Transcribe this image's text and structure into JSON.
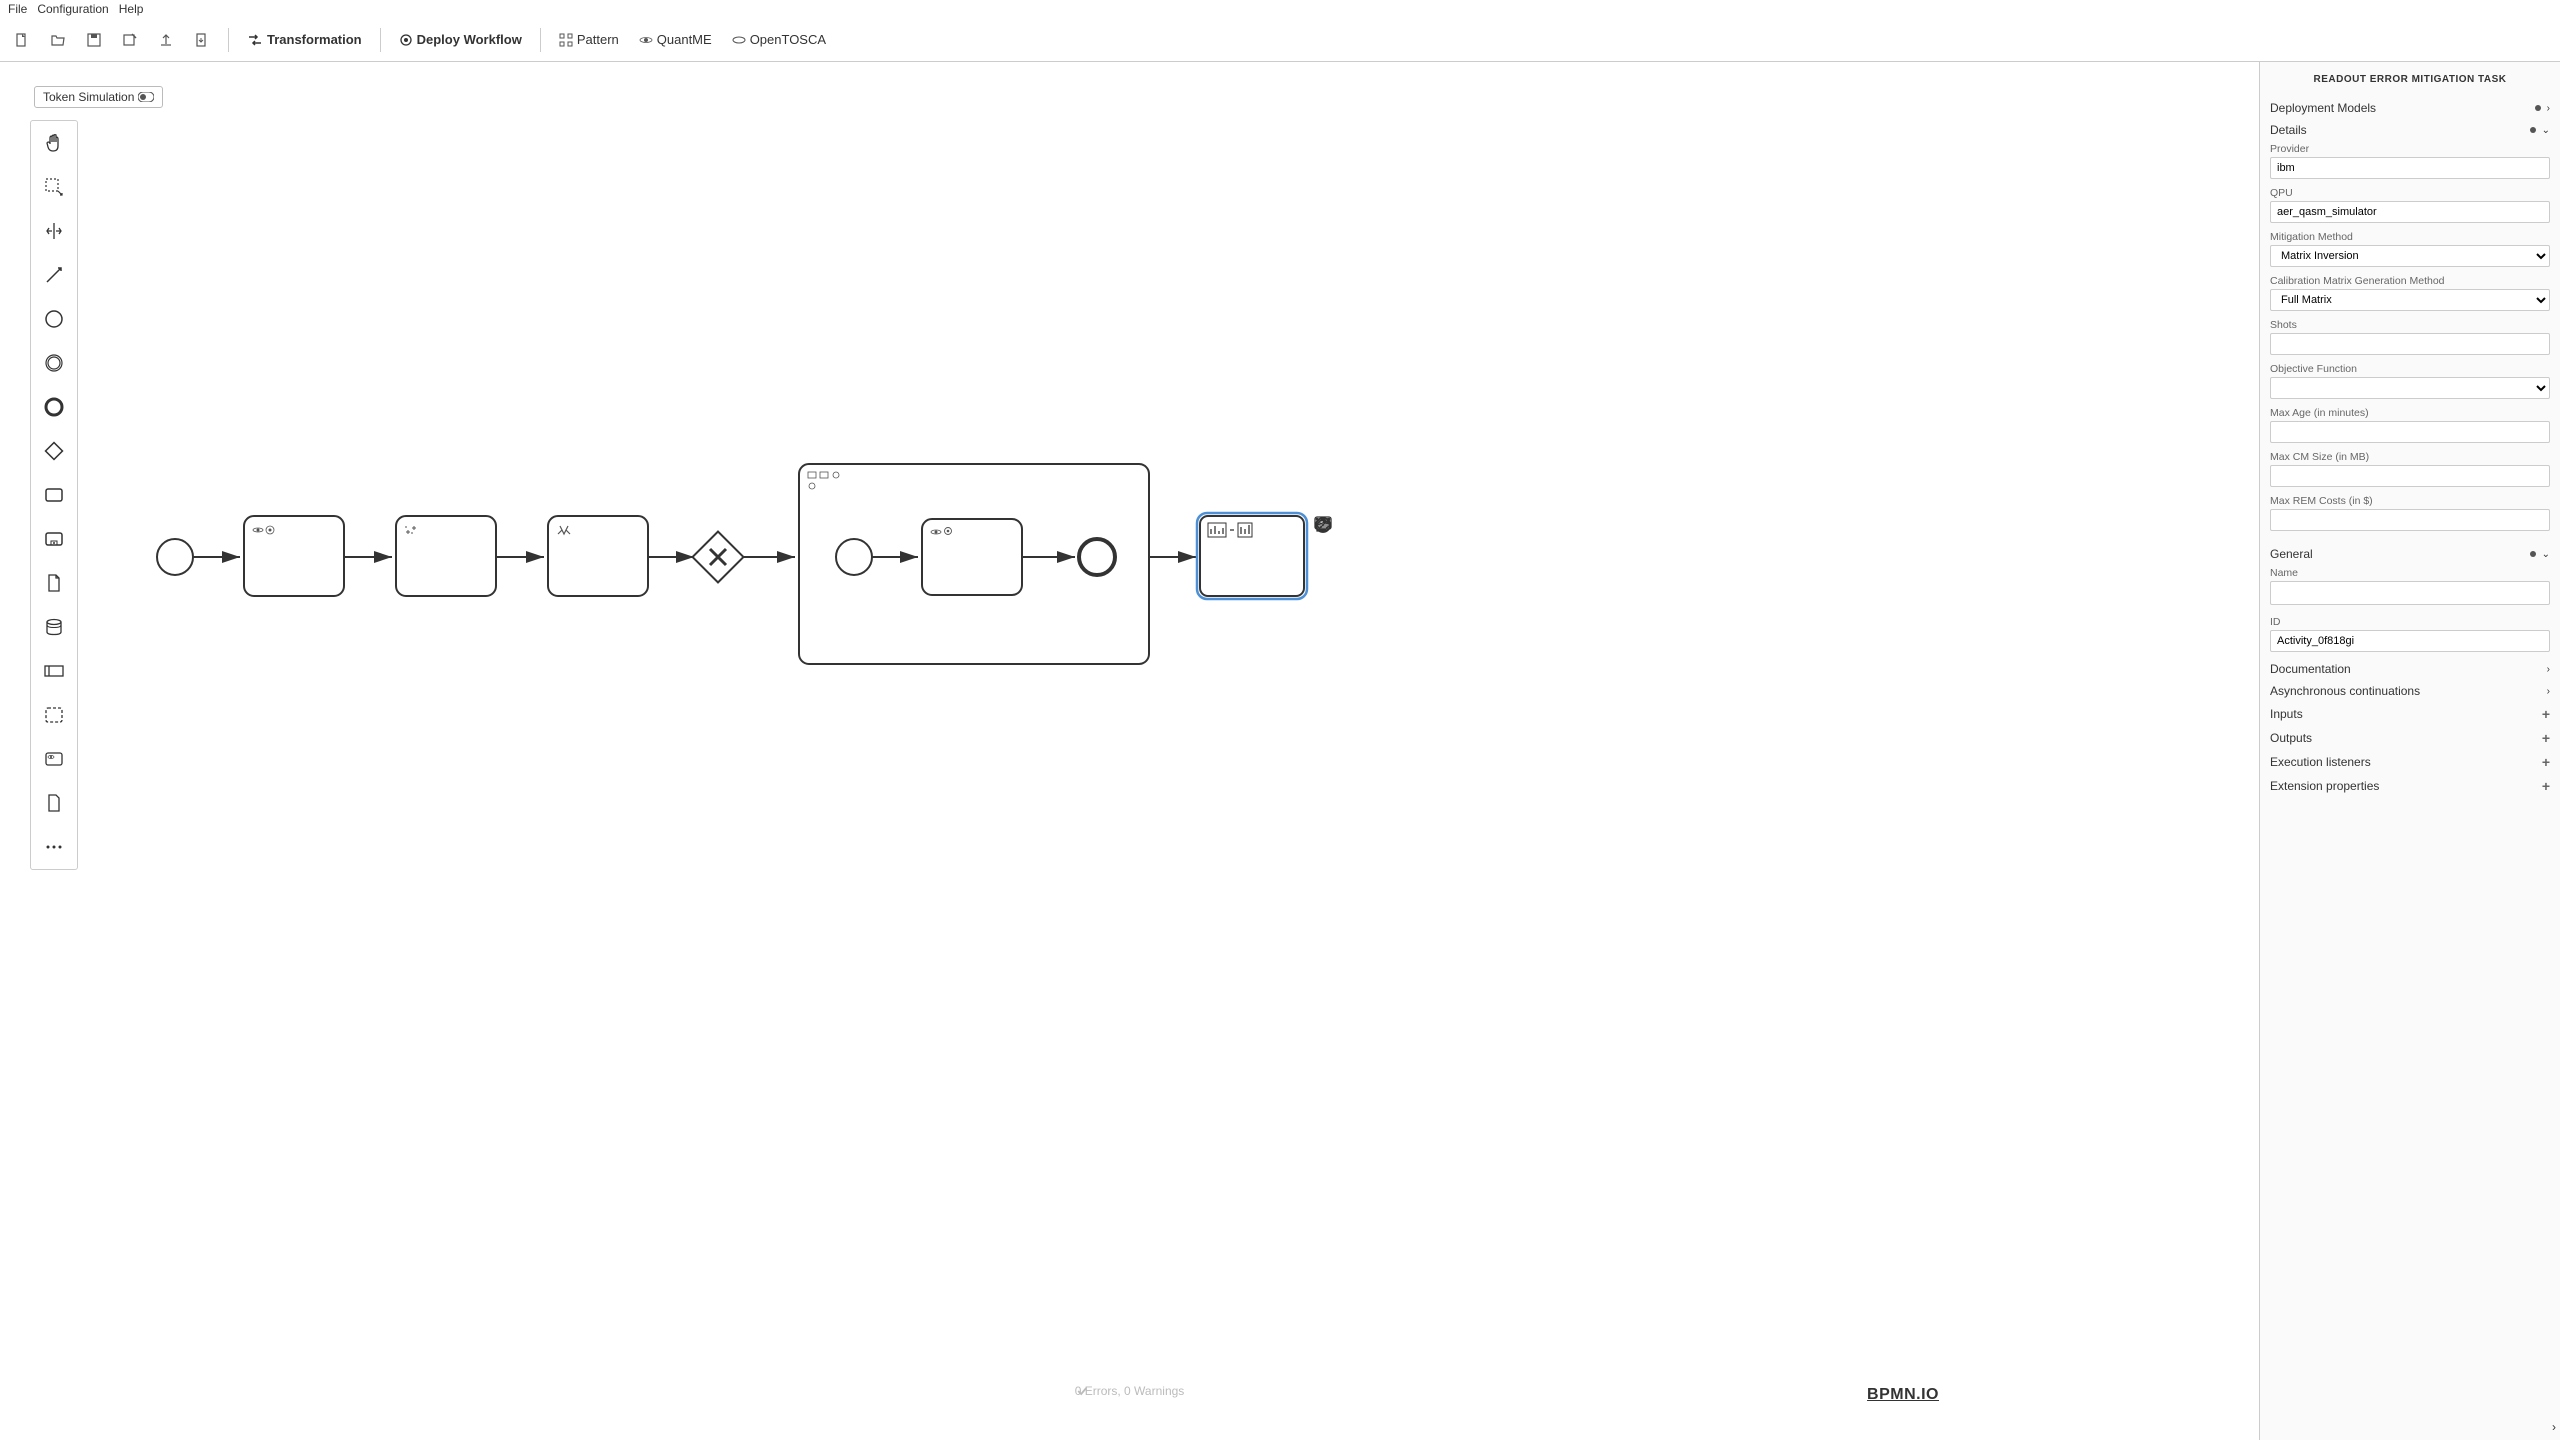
{
  "menu": {
    "file": "File",
    "configuration": "Configuration",
    "help": "Help"
  },
  "toolbar": {
    "transformation": "Transformation",
    "deploy_workflow": "Deploy Workflow",
    "pattern": "Pattern",
    "quantme": "QuantME",
    "opentosca": "OpenTOSCA"
  },
  "token_simulation": "Token Simulation",
  "panel": {
    "title": "READOUT ERROR MITIGATION TASK",
    "sections": {
      "deployment_models": "Deployment Models",
      "details": "Details",
      "general": "General",
      "documentation": "Documentation",
      "async": "Asynchronous continuations",
      "inputs": "Inputs",
      "outputs": "Outputs",
      "execution_listeners": "Execution listeners",
      "extension_properties": "Extension properties"
    },
    "details": {
      "provider_label": "Provider",
      "provider_value": "ibm",
      "qpu_label": "QPU",
      "qpu_value": "aer_qasm_simulator",
      "mitigation_method_label": "Mitigation Method",
      "mitigation_method_value": "Matrix Inversion",
      "calibration_label": "Calibration Matrix Generation Method",
      "calibration_value": "Full Matrix",
      "shots_label": "Shots",
      "shots_value": "",
      "objective_label": "Objective Function",
      "objective_value": "",
      "max_age_label": "Max Age (in minutes)",
      "max_age_value": "",
      "max_cm_label": "Max CM Size (in MB)",
      "max_cm_value": "",
      "max_rem_label": "Max REM Costs (in $)",
      "max_rem_value": ""
    },
    "general": {
      "name_label": "Name",
      "name_value": "",
      "id_label": "ID",
      "id_value": "Activity_0f818gi"
    }
  },
  "status": {
    "errors": "0 Errors, 0 Warnings"
  },
  "logo": "BPMN.IO"
}
